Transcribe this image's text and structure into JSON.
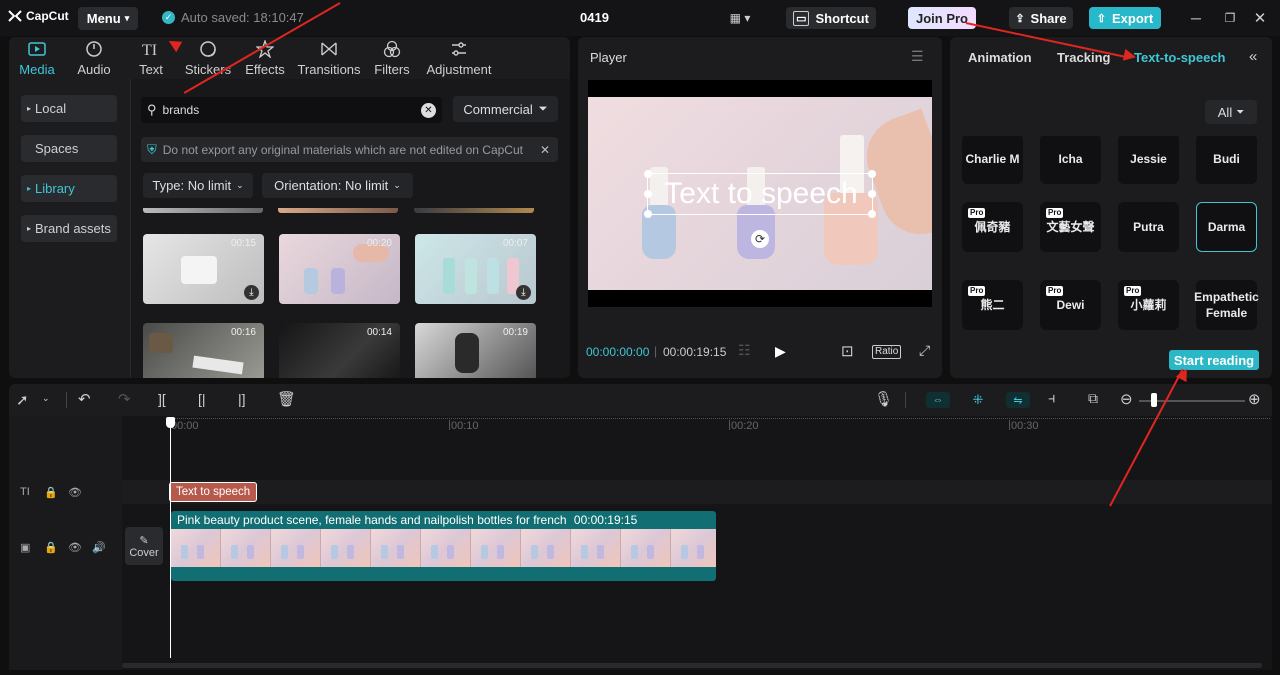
{
  "app": {
    "logo": "CapCut",
    "menu": "Menu",
    "autosave": "Auto saved: 18:10:47",
    "project": "0419"
  },
  "topbar": {
    "join_pro": "Join Pro",
    "shortcut": "Shortcut",
    "share": "Share",
    "export": "Export"
  },
  "media_tools": [
    {
      "label": "Media"
    },
    {
      "label": "Audio"
    },
    {
      "label": "Text"
    },
    {
      "label": "Stickers"
    },
    {
      "label": "Effects"
    },
    {
      "label": "Transitions"
    },
    {
      "label": "Filters"
    },
    {
      "label": "Adjustment"
    }
  ],
  "sidebar": {
    "items": [
      {
        "label": "Local"
      },
      {
        "label": "Spaces"
      },
      {
        "label": "Library"
      },
      {
        "label": "Brand assets"
      }
    ]
  },
  "search": {
    "value": "brands",
    "filter": "Commercial"
  },
  "notice": "Do not export any original materials which are not edited on CapCut",
  "filters": {
    "type": "Type: No limit",
    "orientation": "Orientation: No limit"
  },
  "thumbs": [
    {
      "dur": "00:15"
    },
    {
      "dur": "00:20"
    },
    {
      "dur": "00:07"
    },
    {
      "dur": "00:16"
    },
    {
      "dur": "00:14"
    },
    {
      "dur": "00:19"
    }
  ],
  "player": {
    "title": "Player",
    "overlay_text": "Text to speech",
    "current": "00:00:00:00",
    "total": "00:00:19:15",
    "ratio": "Ratio"
  },
  "right_panel": {
    "tabs": [
      {
        "label": "Animation"
      },
      {
        "label": "Tracking"
      },
      {
        "label": "Text-to-speech"
      }
    ],
    "all": "All",
    "voices": [
      {
        "name": "Charlie M",
        "pro": false
      },
      {
        "name": "Icha",
        "pro": false
      },
      {
        "name": "Jessie",
        "pro": false
      },
      {
        "name": "Budi",
        "pro": false
      },
      {
        "name": "佩奇豬",
        "pro": true
      },
      {
        "name": "文藝女聲",
        "pro": true
      },
      {
        "name": "Putra",
        "pro": false
      },
      {
        "name": "Darma",
        "pro": false
      },
      {
        "name": "熊二",
        "pro": true
      },
      {
        "name": "Dewi",
        "pro": true
      },
      {
        "name": "小蘿莉",
        "pro": true
      },
      {
        "name": "Empathetic Female",
        "pro": false
      }
    ],
    "pro_badge": "Pro",
    "start_reading": "Start reading"
  },
  "timeline": {
    "ruler": [
      "00:00",
      "00:10",
      "00:20",
      "00:30"
    ],
    "text_clip": "Text to speech",
    "video_clip": "Pink beauty product scene, female hands and nailpolish bottles for french",
    "video_dur": "00:00:19:15",
    "cover": "Cover"
  },
  "colors": {
    "accent": "#3ec7d6",
    "text_clip": "#b75a4b",
    "video_clip": "#116e73",
    "arrow": "#e0261f"
  }
}
